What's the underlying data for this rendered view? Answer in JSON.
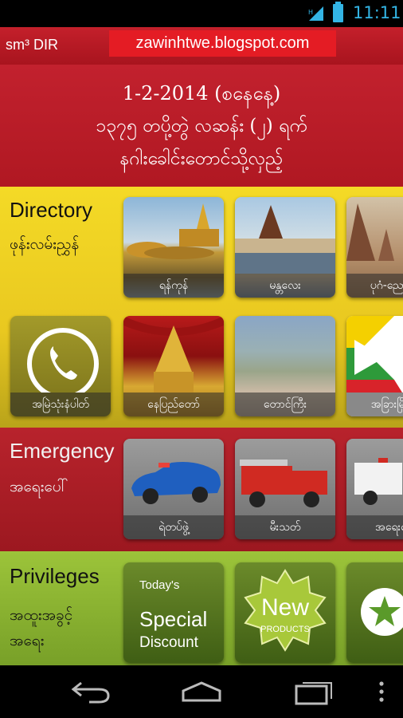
{
  "status_bar": {
    "time": "11:11",
    "accent": "#33b5e5"
  },
  "app_bar": {
    "title": "sm³ DIR",
    "banner": "zawinhtwe.blogspot.com"
  },
  "header": {
    "line1": "1-2-2014 (စနေနေ့)",
    "line2": "၁၃၇၅ တပို့တွဲ လဆန်း (၂) ရက်",
    "line3": "နဂါးခေါင်းတောင်သို့လှည့်"
  },
  "directory": {
    "title": "Directory",
    "subtitle": "ဖုန်းလမ်းညွှန်",
    "row1": [
      "ရန်ကုန်",
      "မန္တလေး",
      "ပုဂံ-ညောင်ဦး"
    ],
    "row2": [
      "အမြဲသုံးနံပါတ်",
      "နေပြည်တော်",
      "တောင်ကြီး",
      "အခြားမြို့များ"
    ]
  },
  "emergency": {
    "title": "Emergency",
    "subtitle": "အရေးပေါ်",
    "tiles": [
      "ရဲတပ်ဖွဲ့",
      "မီးသတ်",
      "အရေးပေါ်"
    ]
  },
  "privileges": {
    "title": "Privileges",
    "subtitle_line1": "အထူးအခွင့်",
    "subtitle_line2": "အရေး",
    "special": {
      "line1": "Today's",
      "line2": "Special",
      "line3": "Discount"
    },
    "new": {
      "line1": "New",
      "line2": "PRODUCTS"
    }
  },
  "nav": {
    "back_icon": "back-icon",
    "home_icon": "home-icon",
    "recents_icon": "recent-apps-icon",
    "menu_icon": "overflow-menu-icon"
  },
  "colors": {
    "header_red": "#c2212e",
    "directory_yellow": "#f4da26",
    "emergency_red": "#b8232c",
    "privileges_green": "#9cc43a"
  }
}
